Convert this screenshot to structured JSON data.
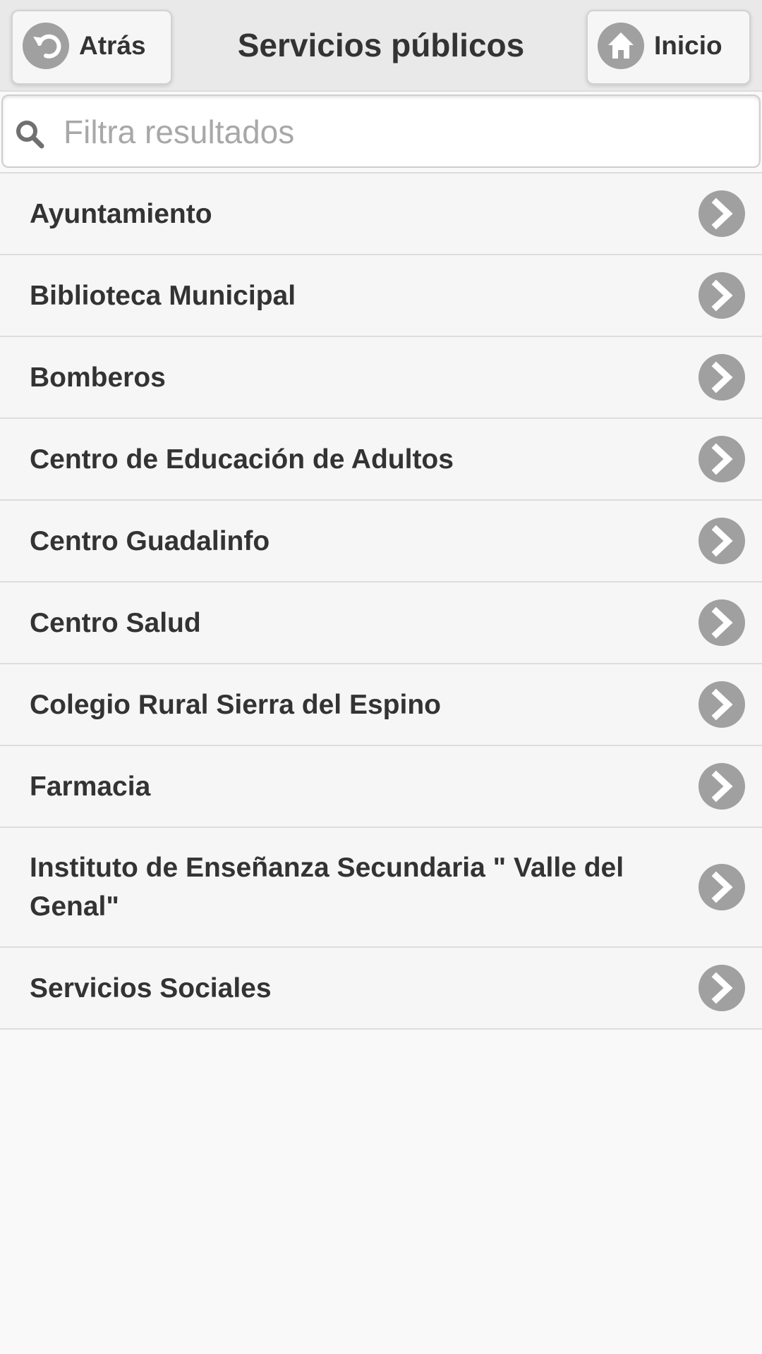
{
  "header": {
    "title": "Servicios públicos",
    "back_label": "Atrás",
    "back_icon": "back-arrow-icon",
    "home_label": "Inicio",
    "home_icon": "home-icon"
  },
  "search": {
    "placeholder": "Filtra resultados",
    "value": "",
    "icon": "search-icon"
  },
  "list": {
    "item_icon": "chevron-right-icon",
    "items": [
      {
        "label": "Ayuntamiento"
      },
      {
        "label": "Biblioteca Municipal"
      },
      {
        "label": "Bomberos"
      },
      {
        "label": "Centro de Educación de Adultos"
      },
      {
        "label": "Centro Guadalinfo"
      },
      {
        "label": "Centro Salud"
      },
      {
        "label": "Colegio Rural Sierra del Espino"
      },
      {
        "label": "Farmacia"
      },
      {
        "label": "Instituto de Enseñanza Secundaria \" Valle del Genal\""
      },
      {
        "label": "Servicios Sociales"
      }
    ]
  },
  "colors": {
    "header_bg": "#e9e9e9",
    "text": "#333333",
    "icon_circle": "#a0a0a0",
    "list_bg": "#f6f6f6",
    "divider": "#dddddd",
    "placeholder": "#a8a8a8"
  }
}
